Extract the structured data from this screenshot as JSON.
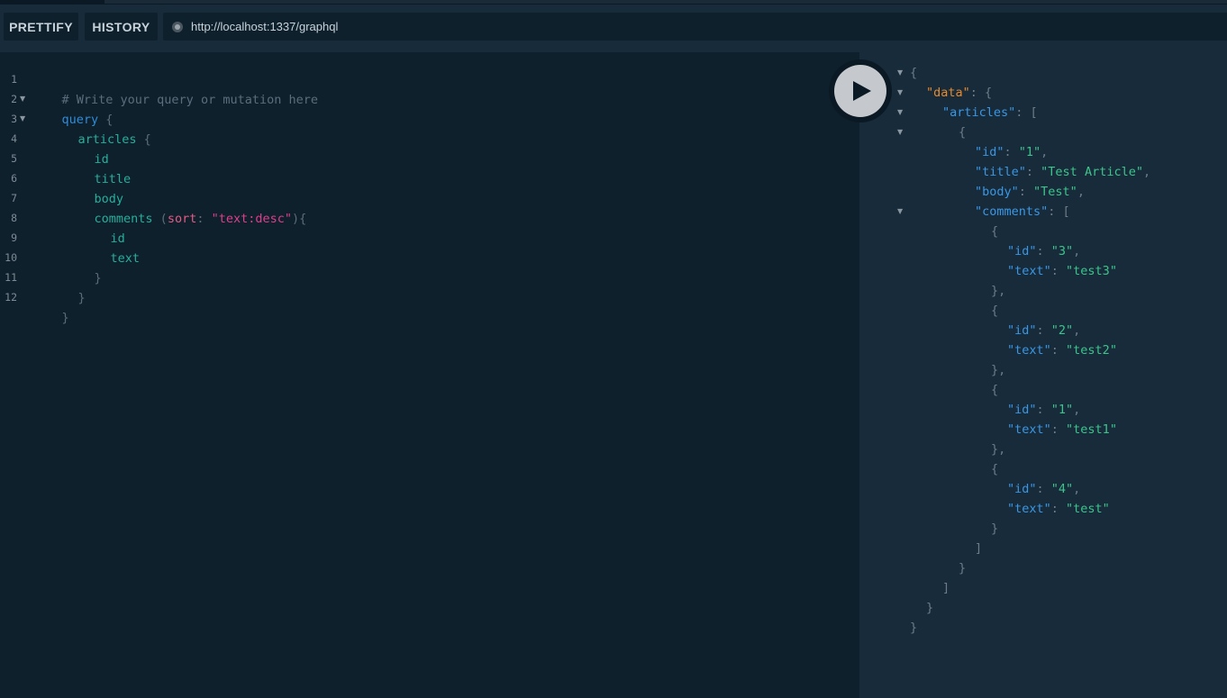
{
  "toolbar": {
    "prettify_label": "PRETTIFY",
    "history_label": "HISTORY",
    "endpoint_url": "http://localhost:1337/graphql"
  },
  "icons": {
    "status": "status-dot-icon",
    "run": "play-icon",
    "fold": "fold-arrow-icon"
  },
  "colors": {
    "keyword": "#2f8bd8",
    "field": "#27ae9b",
    "argument": "#e65a84",
    "string": "#df3e8b",
    "comment": "#5b6d7b",
    "json_key": "#3a97e6",
    "json_data_key": "#e8892b",
    "json_string": "#3dc48c"
  },
  "editor": {
    "line_numbers": [
      "1",
      "2",
      "3",
      "4",
      "5",
      "6",
      "7",
      "8",
      "9",
      "10",
      "11",
      "12"
    ],
    "lines": [
      {
        "comment": "# Write your query or mutation here"
      },
      {
        "keyword": "query",
        "open": " {"
      },
      {
        "field": "articles",
        "open": " {"
      },
      {
        "field": "id"
      },
      {
        "field": "title"
      },
      {
        "field": "body"
      },
      {
        "field": "comments",
        "p1": " (",
        "arg": "sort",
        "p2": ": ",
        "str": "\"text:desc\"",
        "p3": "){"
      },
      {
        "field": "id"
      },
      {
        "field": "text"
      },
      {
        "close": "}"
      },
      {
        "close": "}"
      },
      {
        "close": "}"
      }
    ]
  },
  "result": {
    "lines": [
      {
        "p": "{"
      },
      {
        "key": "\"data\"",
        "p": ": {"
      },
      {
        "key": "\"articles\"",
        "p": ": ["
      },
      {
        "p": "{"
      },
      {
        "key": "\"id\"",
        "p": ": ",
        "val": "\"1\"",
        "tail": ","
      },
      {
        "key": "\"title\"",
        "p": ": ",
        "val": "\"Test Article\"",
        "tail": ","
      },
      {
        "key": "\"body\"",
        "p": ": ",
        "val": "\"Test\"",
        "tail": ","
      },
      {
        "key": "\"comments\"",
        "p": ": ["
      },
      {
        "p": "{"
      },
      {
        "key": "\"id\"",
        "p": ": ",
        "val": "\"3\"",
        "tail": ","
      },
      {
        "key": "\"text\"",
        "p": ": ",
        "val": "\"test3\""
      },
      {
        "p": "},"
      },
      {
        "p": "{"
      },
      {
        "key": "\"id\"",
        "p": ": ",
        "val": "\"2\"",
        "tail": ","
      },
      {
        "key": "\"text\"",
        "p": ": ",
        "val": "\"test2\""
      },
      {
        "p": "},"
      },
      {
        "p": "{"
      },
      {
        "key": "\"id\"",
        "p": ": ",
        "val": "\"1\"",
        "tail": ","
      },
      {
        "key": "\"text\"",
        "p": ": ",
        "val": "\"test1\""
      },
      {
        "p": "},"
      },
      {
        "p": "{"
      },
      {
        "key": "\"id\"",
        "p": ": ",
        "val": "\"4\"",
        "tail": ","
      },
      {
        "key": "\"text\"",
        "p": ": ",
        "val": "\"test\""
      },
      {
        "p": "}"
      },
      {
        "p": "]"
      },
      {
        "p": "}"
      },
      {
        "p": "]"
      },
      {
        "p": "}"
      },
      {
        "p": "}"
      }
    ]
  }
}
